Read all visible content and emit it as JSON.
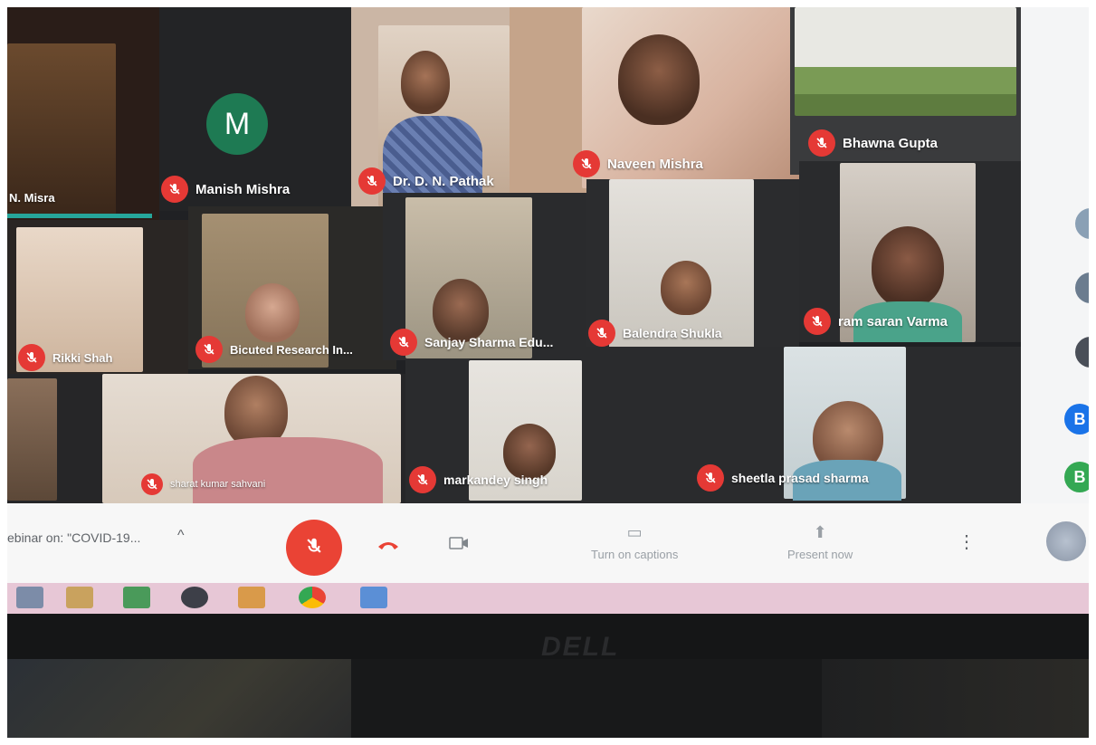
{
  "meeting": {
    "title": "ebinar on: \"COVID-19...",
    "chevron": "^"
  },
  "participants": [
    {
      "name": "N. Misra"
    },
    {
      "name": "Manish Mishra",
      "avatar_letter": "M"
    },
    {
      "name": "Dr. D. N. Pathak"
    },
    {
      "name": "Naveen Mishra"
    },
    {
      "name": "Bhawna Gupta"
    },
    {
      "name": "Rikki Shah"
    },
    {
      "name": "Bicuted Research In..."
    },
    {
      "name": "Sanjay Sharma Edu..."
    },
    {
      "name": "Balendra Shukla"
    },
    {
      "name": "ram saran Varma"
    },
    {
      "name": "sharat kumar sahvani"
    },
    {
      "name": "markandey singh"
    },
    {
      "name": "sheetla prasad sharma"
    }
  ],
  "side_rail": {
    "avatars": [
      "B",
      "B"
    ]
  },
  "controls": {
    "captions_label": "Turn on captions",
    "present_label": "Present now",
    "more_icon": "more-vert-icon",
    "mic_icon": "mic-off-icon",
    "end_icon": "call-end-icon",
    "camera_icon": "camera-icon"
  },
  "monitor": {
    "brand": "DELL"
  },
  "colors": {
    "mute_red": "#e53935",
    "avatar_green": "#1e7a53",
    "rail_blue": "#1a73e8",
    "rail_green": "#34a853",
    "taskbar": "#e7c7d6"
  }
}
